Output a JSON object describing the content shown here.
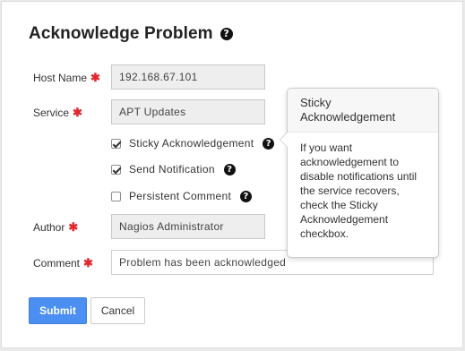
{
  "dialog": {
    "title": "Acknowledge Problem"
  },
  "form": {
    "host": {
      "label": "Host Name",
      "value": "192.168.67.101"
    },
    "service": {
      "label": "Service",
      "value": "APT Updates"
    },
    "sticky": {
      "label": "Sticky Acknowledgement",
      "checked": true
    },
    "notify": {
      "label": "Send Notification",
      "checked": true
    },
    "persistent": {
      "label": "Persistent Comment",
      "checked": false
    },
    "author": {
      "label": "Author",
      "value": "Nagios Administrator"
    },
    "comment": {
      "label": "Comment",
      "value": "Problem has been acknowledged"
    },
    "required_marker": "✱"
  },
  "buttons": {
    "submit": "Submit",
    "cancel": "Cancel"
  },
  "popover": {
    "title": "Sticky Acknowledgement",
    "body": "If you want acknowledgement to disable notifications until the service recovers, check the Sticky Acknowledgement checkbox."
  },
  "icons": {
    "help": "?"
  },
  "colors": {
    "primary": "#4b8ff2",
    "required": "#e0282e",
    "readonly_bg": "#eeeeee"
  }
}
